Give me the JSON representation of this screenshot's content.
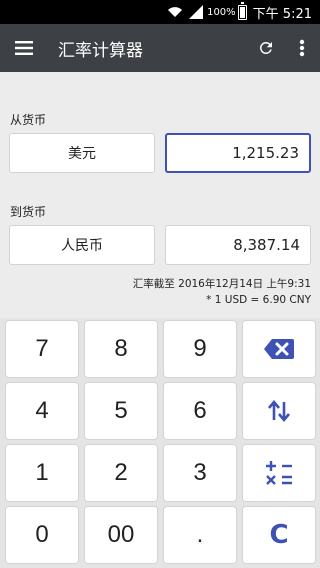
{
  "status_bar": {
    "battery_percent": "100%",
    "time": "下午 5:21"
  },
  "app_bar": {
    "title": "汇率计算器"
  },
  "from": {
    "label": "从货币",
    "currency": "美元",
    "amount": "1,215.23"
  },
  "to": {
    "label": "到货币",
    "currency": "人民币",
    "amount": "8,387.14"
  },
  "rate_info": {
    "updated": "汇率截至 2016年12月14日 上午9:31",
    "rate": "* 1 USD = 6.90 CNY"
  },
  "keypad": {
    "digits": {
      "d7": "7",
      "d8": "8",
      "d9": "9",
      "d4": "4",
      "d5": "5",
      "d6": "6",
      "d1": "1",
      "d2": "2",
      "d3": "3",
      "d0": "0",
      "d00": "00",
      "dot": "."
    },
    "clear": "C",
    "icons": {
      "backspace": "backspace-icon",
      "swap": "swap-icon",
      "operators": "operators-icon"
    }
  },
  "colors": {
    "accent": "#3f51b5",
    "app_bar": "#3d4045",
    "status_bar": "#000000",
    "background": "#ececec"
  }
}
